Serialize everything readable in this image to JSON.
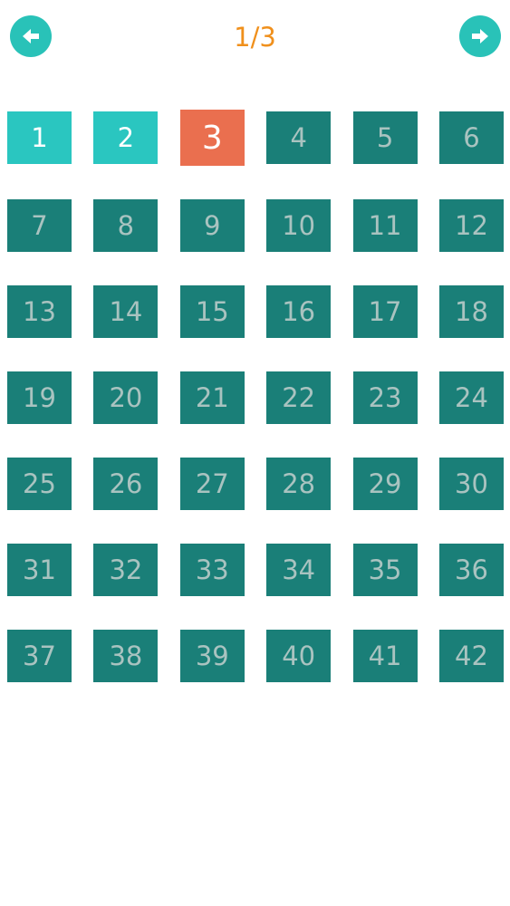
{
  "header": {
    "page_indicator": "1/3",
    "prev_icon": "arrow-left-icon",
    "next_icon": "arrow-right-icon"
  },
  "colors": {
    "nav_button": "#29c2b8",
    "page_indicator": "#f0901c",
    "level_locked": "#1a7f78",
    "level_completed": "#2ac6c0",
    "level_current": "#ea6f4f"
  },
  "levels": [
    {
      "label": "1",
      "state": "completed"
    },
    {
      "label": "2",
      "state": "completed"
    },
    {
      "label": "3",
      "state": "current"
    },
    {
      "label": "4",
      "state": "locked"
    },
    {
      "label": "5",
      "state": "locked"
    },
    {
      "label": "6",
      "state": "locked"
    },
    {
      "label": "7",
      "state": "locked"
    },
    {
      "label": "8",
      "state": "locked"
    },
    {
      "label": "9",
      "state": "locked"
    },
    {
      "label": "10",
      "state": "locked"
    },
    {
      "label": "11",
      "state": "locked"
    },
    {
      "label": "12",
      "state": "locked"
    },
    {
      "label": "13",
      "state": "locked"
    },
    {
      "label": "14",
      "state": "locked"
    },
    {
      "label": "15",
      "state": "locked"
    },
    {
      "label": "16",
      "state": "locked"
    },
    {
      "label": "17",
      "state": "locked"
    },
    {
      "label": "18",
      "state": "locked"
    },
    {
      "label": "19",
      "state": "locked"
    },
    {
      "label": "20",
      "state": "locked"
    },
    {
      "label": "21",
      "state": "locked"
    },
    {
      "label": "22",
      "state": "locked"
    },
    {
      "label": "23",
      "state": "locked"
    },
    {
      "label": "24",
      "state": "locked"
    },
    {
      "label": "25",
      "state": "locked"
    },
    {
      "label": "26",
      "state": "locked"
    },
    {
      "label": "27",
      "state": "locked"
    },
    {
      "label": "28",
      "state": "locked"
    },
    {
      "label": "29",
      "state": "locked"
    },
    {
      "label": "30",
      "state": "locked"
    },
    {
      "label": "31",
      "state": "locked"
    },
    {
      "label": "32",
      "state": "locked"
    },
    {
      "label": "33",
      "state": "locked"
    },
    {
      "label": "34",
      "state": "locked"
    },
    {
      "label": "35",
      "state": "locked"
    },
    {
      "label": "36",
      "state": "locked"
    },
    {
      "label": "37",
      "state": "locked"
    },
    {
      "label": "38",
      "state": "locked"
    },
    {
      "label": "39",
      "state": "locked"
    },
    {
      "label": "40",
      "state": "locked"
    },
    {
      "label": "41",
      "state": "locked"
    },
    {
      "label": "42",
      "state": "locked"
    }
  ]
}
